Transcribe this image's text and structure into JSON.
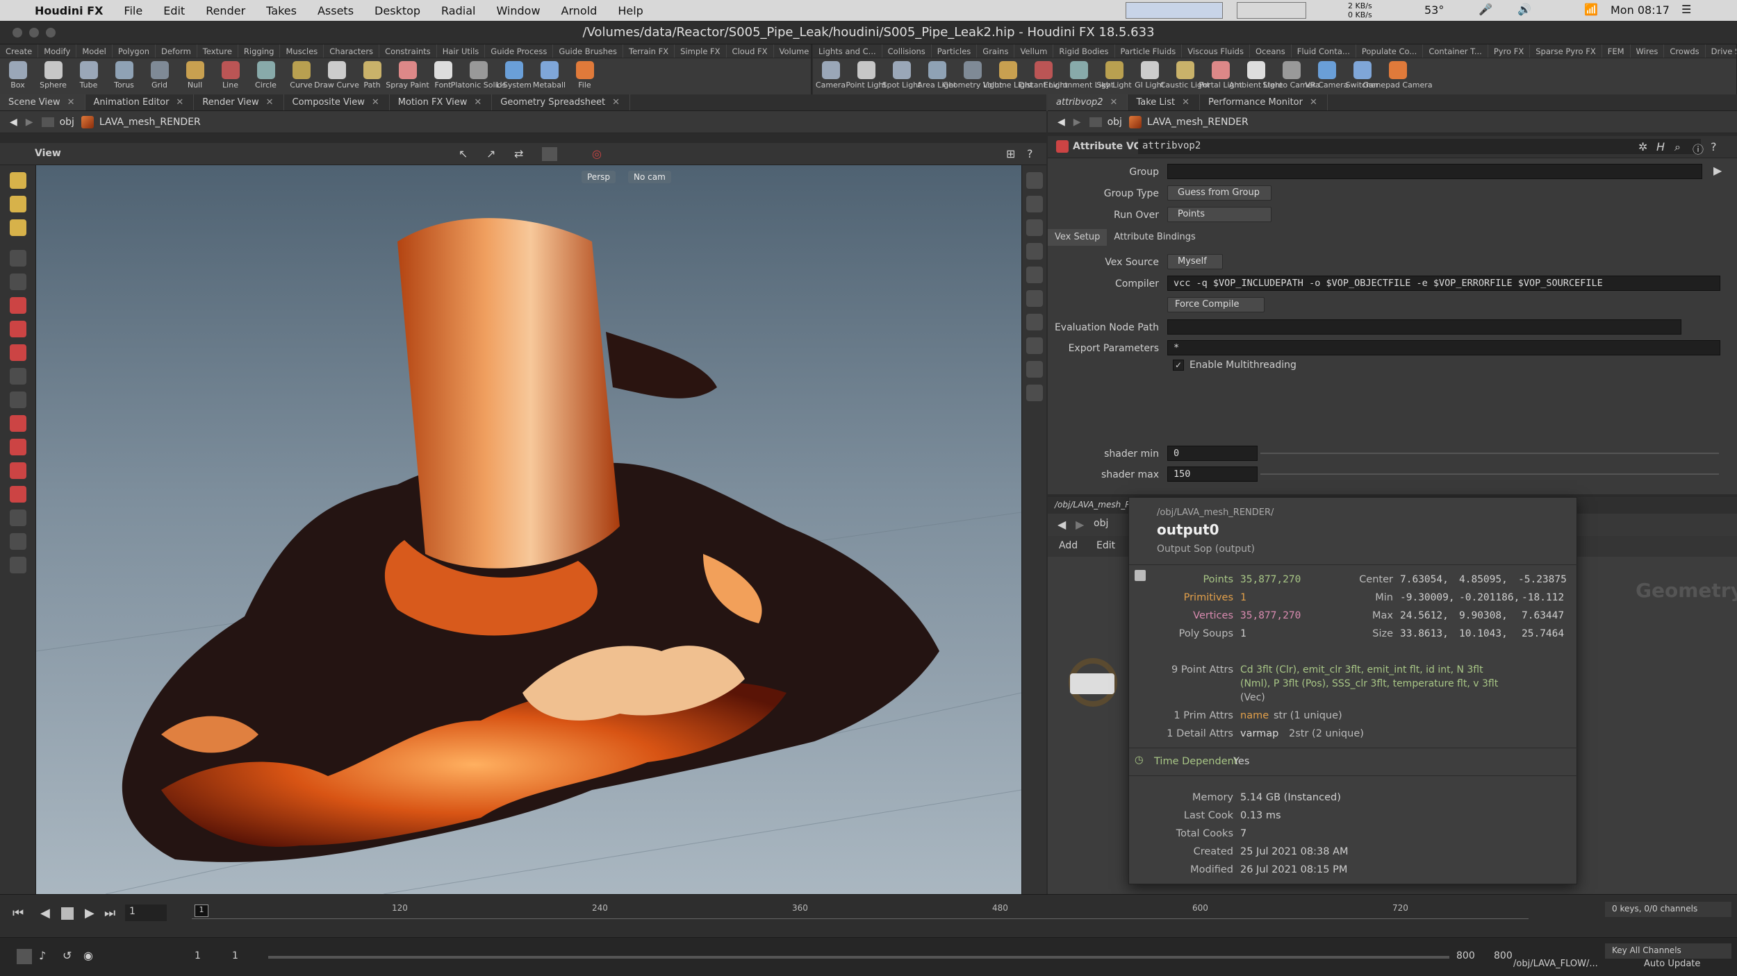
{
  "macmenu": {
    "apple": "",
    "app": "Houdini FX",
    "items": [
      "File",
      "Edit",
      "Render",
      "Takes",
      "Assets",
      "Desktop",
      "Radial",
      "Window",
      "Arnold",
      "Help"
    ],
    "net_up": "2 KB/s",
    "net_down": "0 KB/s",
    "temp": "53°",
    "clock": "Mon 08:17"
  },
  "window": {
    "title": "/Volumes/data/Reactor/S005_Pipe_Leak/houdini/S005_Pipe_Leak2.hip - Houdini FX 18.5.633"
  },
  "shelf_left": {
    "tabs": [
      "Create",
      "Modify",
      "Model",
      "Polygon",
      "Deform",
      "Texture",
      "Rigging",
      "Muscles",
      "Characters",
      "Constraints",
      "Hair Utils",
      "Guide Process",
      "Guide Brushes",
      "Terrain FX",
      "Simple FX",
      "Cloud FX",
      "Volume"
    ],
    "tools": [
      "Box",
      "Sphere",
      "Tube",
      "Torus",
      "Grid",
      "Null",
      "Line",
      "Circle",
      "Curve",
      "Draw Curve",
      "Path",
      "Spray Paint",
      "Font",
      "Platonic Solids",
      "L-System",
      "Metaball",
      "File"
    ]
  },
  "shelf_right": {
    "tabs": [
      "Lights and C...",
      "Collisions",
      "Particles",
      "Grains",
      "Vellum",
      "Rigid Bodies",
      "Particle Fluids",
      "Viscous Fluids",
      "Oceans",
      "Fluid Conta...",
      "Populate Co...",
      "Container T...",
      "Pyro FX",
      "Sparse Pyro FX",
      "FEM",
      "Wires",
      "Crowds",
      "Drive Simul..."
    ],
    "tools": [
      "Camera",
      "Point Light",
      "Spot Light",
      "Area Light",
      "Geometry Light",
      "Volume Light",
      "Distant Light",
      "Environment Light",
      "Sky Light",
      "GI Light",
      "Caustic Light",
      "Portal Light",
      "Ambient Light",
      "Stereo Camera",
      "VR Camera",
      "Switcher",
      "Gamepad Camera"
    ]
  },
  "left_tabs": [
    "Scene View",
    "Animation Editor",
    "Render View",
    "Composite View",
    "Motion FX View",
    "Geometry Spreadsheet"
  ],
  "left_path": {
    "root": "obj",
    "node": "LAVA_mesh_RENDER"
  },
  "viewport": {
    "label": "View",
    "persp": "Persp",
    "cam": "No cam"
  },
  "right_tabs": [
    "attribvop2",
    "Take List",
    "Performance Monitor"
  ],
  "right_path": {
    "root": "obj",
    "node": "LAVA_mesh_RENDER"
  },
  "parm": {
    "node_type": "Attribute VOP",
    "node_name": "attribvop2",
    "group_label": "Group",
    "group_value": "",
    "group_type_label": "Group Type",
    "group_type_value": "Guess from Group",
    "run_over_label": "Run Over",
    "run_over_value": "Points",
    "tabs": [
      "Vex Setup",
      "Attribute Bindings"
    ],
    "vex_source_label": "Vex Source",
    "vex_source_value": "Myself",
    "compiler_label": "Compiler",
    "compiler_value": "vcc -q $VOP_INCLUDEPATH -o $VOP_OBJECTFILE -e $VOP_ERRORFILE $VOP_SOURCEFILE",
    "force_compile": "Force Compile",
    "eval_path_label": "Evaluation Node Path",
    "eval_path_value": "",
    "export_label": "Export Parameters",
    "export_value": "*",
    "multithread_label": "Enable Multithreading",
    "shader_min_label": "shader min",
    "shader_min_value": "0",
    "shader_max_label": "shader max",
    "shader_max_value": "150"
  },
  "network": {
    "path": "/obj/LAVA_mesh_RE",
    "root": "obj",
    "add": "Add",
    "edit": "Edit",
    "watermark": "Geometry"
  },
  "info": {
    "path": "/obj/LAVA_mesh_RENDER/",
    "name": "output0",
    "type": "Output Sop (output)",
    "points_label": "Points",
    "points": "35,877,270",
    "prims_label": "Primitives",
    "prims": "1",
    "verts_label": "Vertices",
    "verts": "35,877,270",
    "polysoups_label": "Poly Soups",
    "polysoups": "1",
    "center_label": "Center",
    "center": [
      "7.63054,",
      "4.85095,",
      "-5.23875"
    ],
    "min_label": "Min",
    "min": [
      "-9.30009,",
      "-0.201186,",
      "-18.112"
    ],
    "max_label": "Max",
    "max": [
      "24.5612,",
      "9.90308,",
      "7.63447"
    ],
    "size_label": "Size",
    "size": [
      "33.8613,",
      "10.1043,",
      "25.7464"
    ],
    "point_attrs_label": "9 Point Attrs",
    "point_attrs_1": "Cd 3flt (Clr), emit_clr 3flt, emit_int flt, id int, N 3flt",
    "point_attrs_2": "(Nml), P 3flt (Pos), SSS_clr 3flt, temperature flt, v 3flt",
    "point_attrs_3": "(Vec)",
    "prim_attrs_label": "1 Prim Attrs",
    "prim_attrs": "name",
    "prim_attrs_type": "str (1 unique)",
    "detail_attrs_label": "1 Detail Attrs",
    "detail_attrs": "varmap",
    "detail_attrs_type": "2str (2 unique)",
    "time_dep_label": "Time Dependent",
    "time_dep": "Yes",
    "memory_label": "Memory",
    "memory": "5.14 GB (Instanced)",
    "lastcook_label": "Last Cook",
    "lastcook": "0.13 ms",
    "totalcooks_label": "Total Cooks",
    "totalcooks": "7",
    "created_label": "Created",
    "created": "25 Jul 2021 08:38 AM",
    "modified_label": "Modified",
    "modified": "26 Jul 2021 08:15 PM"
  },
  "timeline": {
    "frame": "1",
    "ticks": [
      "1",
      "120",
      "240",
      "360",
      "480",
      "600",
      "720"
    ],
    "keys": "0 keys, 0/0 channels",
    "key_all": "Key All Channels",
    "start": "1",
    "start2": "1",
    "end": "800",
    "end2": "800"
  },
  "status": {
    "path": "/obj/LAVA_FLOW/...",
    "update": "Auto Update"
  },
  "colors": {
    "accent": "#d7b24a",
    "lava": "#e0793a"
  }
}
